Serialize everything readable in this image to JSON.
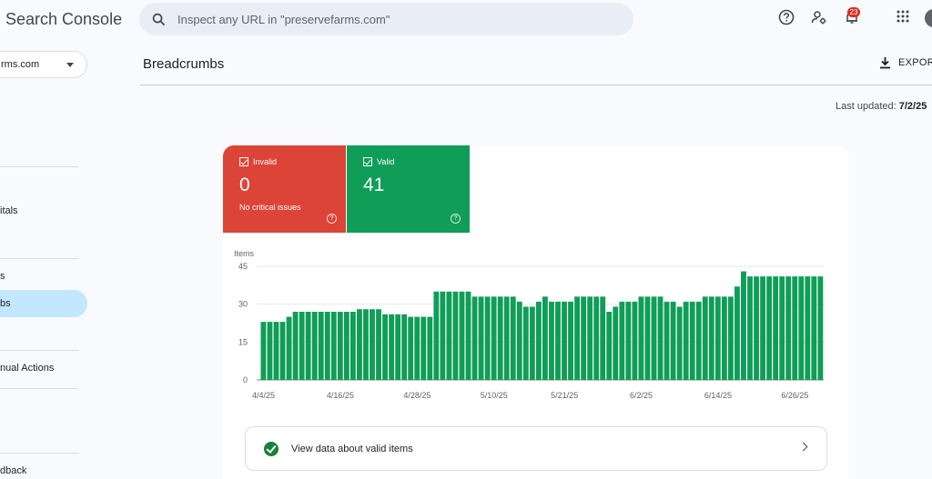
{
  "app": {
    "title": "Search Console"
  },
  "search": {
    "placeholder": "Inspect any URL in \"preservefarms.com\"",
    "value": ""
  },
  "topbar": {
    "help_icon": "help-circle-icon",
    "account_icon": "manage-accounts-icon",
    "notifications_icon": "bell-icon",
    "notifications_count": "23",
    "apps_icon": "apps-grid-icon"
  },
  "sidebar": {
    "property": "rms.com",
    "items": [
      {
        "label": "itals"
      },
      {
        "label": "s"
      },
      {
        "label": "bs",
        "active": true
      },
      {
        "label": "nual Actions"
      },
      {
        "label": "dback"
      }
    ]
  },
  "header": {
    "title": "Breadcrumbs",
    "export_label": "EXPORT",
    "last_updated_label": "Last updated:",
    "last_updated_value": "7/2/25"
  },
  "tiles": {
    "invalid": {
      "label": "Invalid",
      "count": "0",
      "subtext": "No critical issues",
      "color": "#db4437"
    },
    "valid": {
      "label": "Valid",
      "count": "41",
      "color": "#0f9d58"
    }
  },
  "chart_data": {
    "type": "bar",
    "ylabel": "Items",
    "ylim": [
      0,
      45
    ],
    "yticks": [
      0,
      15,
      30,
      45
    ],
    "xtick_labels": [
      "4/4/25",
      "4/16/25",
      "4/28/25",
      "5/10/25",
      "5/21/25",
      "6/2/25",
      "6/14/25",
      "6/26/25"
    ],
    "xtick_indices": [
      0,
      12,
      24,
      36,
      47,
      59,
      71,
      83
    ],
    "series": [
      {
        "color": "#0f9d58",
        "values": [
          23,
          23,
          23,
          23,
          25,
          27,
          27,
          27,
          27,
          27,
          27,
          27,
          27,
          27,
          27,
          28,
          28,
          28,
          28,
          26,
          26,
          26,
          26,
          25,
          25,
          25,
          25,
          35,
          35,
          35,
          35,
          35,
          35,
          33,
          33,
          33,
          33,
          33,
          33,
          33,
          31,
          29,
          29,
          31,
          33,
          31,
          31,
          31,
          31,
          33,
          33,
          33,
          33,
          33,
          27,
          29,
          31,
          31,
          31,
          33,
          33,
          33,
          33,
          31,
          31,
          29,
          31,
          31,
          31,
          33,
          33,
          33,
          33,
          33,
          37,
          43,
          41,
          41,
          41,
          41,
          41,
          41,
          41,
          41,
          41,
          41,
          41,
          41
        ]
      }
    ]
  },
  "valid_link": {
    "label": "View data about valid items"
  }
}
